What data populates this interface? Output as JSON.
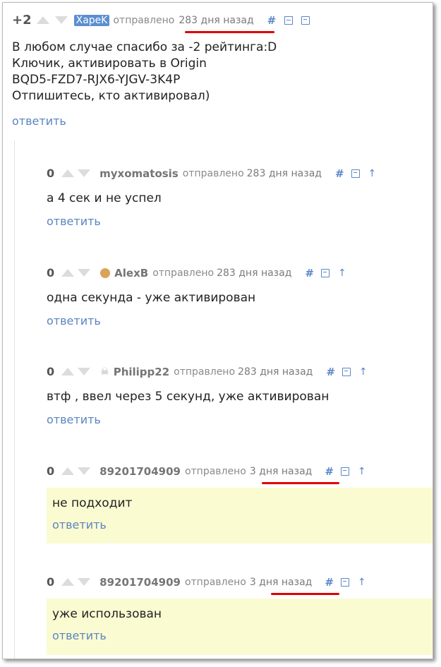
{
  "top_comment": {
    "rating": "+2",
    "author": "XapeK",
    "sent_label": "отправлено",
    "time": "283 дня назад",
    "hash": "#",
    "lines": [
      "В любом случае спасибо за -2 рейтинга:D",
      "Ключик, активировать в Origin",
      "BQD5-FZD7-RJX6-YJGV-3K4P",
      "Отпишитесь, кто активировал)"
    ],
    "reply": "ответить"
  },
  "replies": [
    {
      "rating": "0",
      "author": "myxomatosis",
      "sent_label": "отправлено",
      "time": "283 дня назад",
      "hash": "#",
      "up": "↑",
      "text": "а 4 сек и не успел",
      "reply": "ответить"
    },
    {
      "rating": "0",
      "author": "AlexB",
      "sent_label": "отправлено",
      "time": "283 дня назад",
      "hash": "#",
      "up": "↑",
      "text": "одна секунда - уже активирован",
      "reply": "ответить"
    },
    {
      "rating": "0",
      "author": "Philipp22",
      "sent_label": "отправлено",
      "time": "283 дня назад",
      "hash": "#",
      "up": "↑",
      "text": "втф , ввел через 5 секунд, уже активирован",
      "reply": "ответить"
    },
    {
      "rating": "0",
      "author": "89201704909",
      "sent_label": "отправлено",
      "time": "3 дня назад",
      "hash": "#",
      "up": "↑",
      "text": "не подходит",
      "reply": "ответить"
    },
    {
      "rating": "0",
      "author": "89201704909",
      "sent_label": "отправлено",
      "time": "3 дня назад",
      "hash": "#",
      "up": "↑",
      "text": "уже использован",
      "reply": "ответить"
    }
  ],
  "colors": {
    "link": "#5a84c0",
    "highlight": "#fbfbd2",
    "underline": "#e00000",
    "author_badge": "#5b8fd0"
  }
}
